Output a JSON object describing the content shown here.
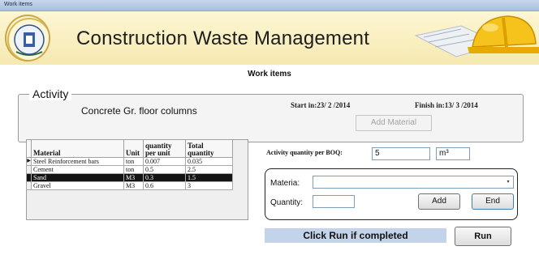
{
  "window": {
    "title": "Work items"
  },
  "header": {
    "app_title": "Construction Waste Management"
  },
  "screen_title": "Work items",
  "activity": {
    "legend": "Activity",
    "name": "Concrete Gr. floor columns",
    "start_label": "Start in:23/ 2 /2014",
    "finish_label": "Finish in:13/ 3 /2014",
    "add_material_button": "Add Material"
  },
  "materials_table": {
    "columns": [
      "Material",
      "Unit",
      "quantity per unit",
      "Total quantity"
    ],
    "rows": [
      {
        "marker": "▶",
        "material": "Steel Reinforcement bars",
        "unit": "ton",
        "qty_per_unit": "0.007",
        "total": "0.035"
      },
      {
        "marker": "",
        "material": "Cement",
        "unit": "ton",
        "qty_per_unit": "0.5",
        "total": "2.5"
      },
      {
        "marker": "",
        "material": "Sand",
        "unit": "M3",
        "qty_per_unit": "0.3",
        "total": "1.5"
      },
      {
        "marker": "",
        "material": "Gravel",
        "unit": "M3",
        "qty_per_unit": "0.6",
        "total": "3"
      }
    ],
    "selected_row": "Sand"
  },
  "boq": {
    "label": "Activity quantity per BOQ:",
    "quantity_value": "5",
    "unit_value": "m³"
  },
  "add_form": {
    "material_label": "Materia:",
    "material_value": "",
    "quantity_label": "Quantity:",
    "quantity_value": "",
    "add_button": "Add",
    "end_button": "End"
  },
  "footer": {
    "hint": "Click Run if completed",
    "run_button": "Run"
  },
  "colors": {
    "header_bg": "#f5e9b0",
    "hint_bg": "#c3d4ea",
    "selected_row_bg": "#141414"
  }
}
